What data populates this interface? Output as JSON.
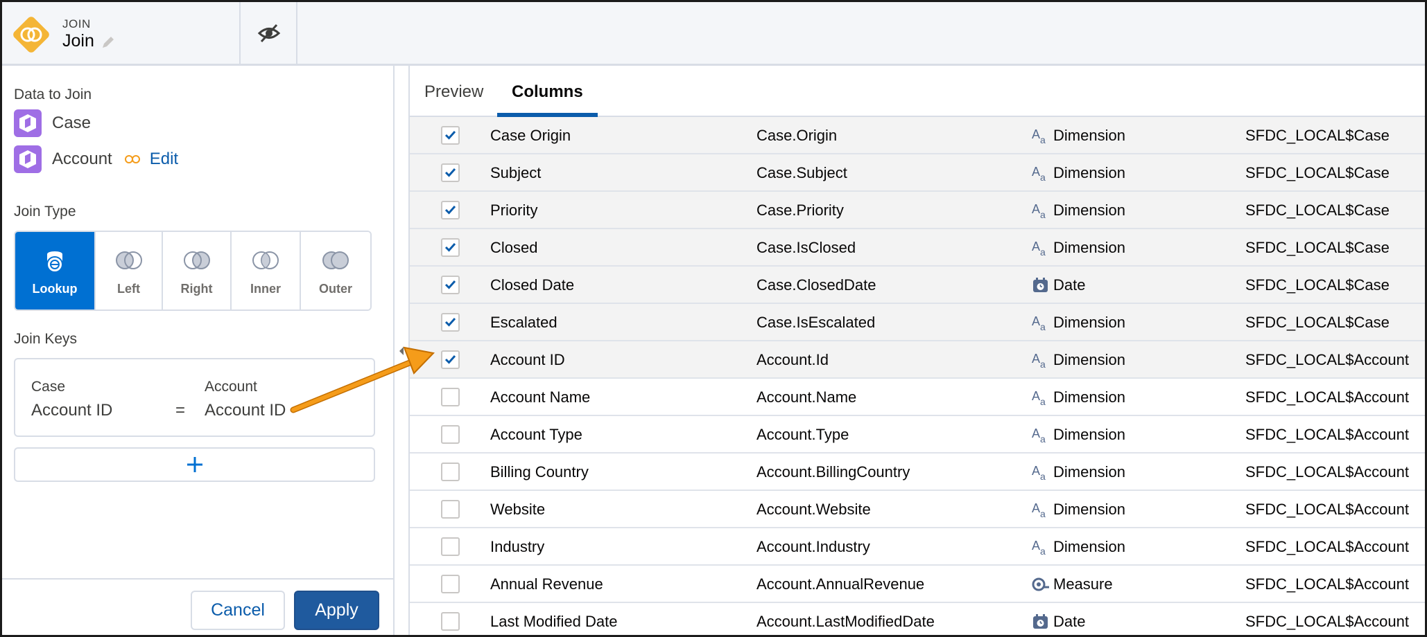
{
  "header": {
    "node_type": "JOIN",
    "node_name": "Join"
  },
  "data_to_join": {
    "label": "Data to Join",
    "sources": [
      {
        "name": "Case"
      },
      {
        "name": "Account",
        "edit_label": "Edit"
      }
    ]
  },
  "join_type": {
    "label": "Join Type",
    "options": [
      "Lookup",
      "Left",
      "Right",
      "Inner",
      "Outer"
    ],
    "selected": "Lookup"
  },
  "join_keys": {
    "label": "Join Keys",
    "left_header": "Case",
    "right_header": "Account",
    "left_value": "Account ID",
    "operator": "=",
    "right_value": "Account ID"
  },
  "footer": {
    "cancel_label": "Cancel",
    "apply_label": "Apply"
  },
  "tabs": {
    "preview": "Preview",
    "columns": "Columns",
    "active": "Columns"
  },
  "colors": {
    "accent": "#0070d2",
    "node_icon": "#f4b536",
    "dataset_icon": "#9f6ee5",
    "arrow": "#f59c1a"
  },
  "columns": [
    {
      "checked": true,
      "label": "Case Origin",
      "api": "Case.Origin",
      "type": "Dimension",
      "icon": "text-type-icon",
      "source": "SFDC_LOCAL$Case"
    },
    {
      "checked": true,
      "label": "Subject",
      "api": "Case.Subject",
      "type": "Dimension",
      "icon": "text-type-icon",
      "source": "SFDC_LOCAL$Case"
    },
    {
      "checked": true,
      "label": "Priority",
      "api": "Case.Priority",
      "type": "Dimension",
      "icon": "text-type-icon",
      "source": "SFDC_LOCAL$Case"
    },
    {
      "checked": true,
      "label": "Closed",
      "api": "Case.IsClosed",
      "type": "Dimension",
      "icon": "text-type-icon",
      "source": "SFDC_LOCAL$Case"
    },
    {
      "checked": true,
      "label": "Closed Date",
      "api": "Case.ClosedDate",
      "type": "Date",
      "icon": "calendar-icon",
      "source": "SFDC_LOCAL$Case"
    },
    {
      "checked": true,
      "label": "Escalated",
      "api": "Case.IsEscalated",
      "type": "Dimension",
      "icon": "text-type-icon",
      "source": "SFDC_LOCAL$Case"
    },
    {
      "checked": true,
      "label": "Account ID",
      "api": "Account.Id",
      "type": "Dimension",
      "icon": "text-type-icon",
      "source": "SFDC_LOCAL$Account"
    },
    {
      "checked": false,
      "label": "Account Name",
      "api": "Account.Name",
      "type": "Dimension",
      "icon": "text-type-icon",
      "source": "SFDC_LOCAL$Account"
    },
    {
      "checked": false,
      "label": "Account Type",
      "api": "Account.Type",
      "type": "Dimension",
      "icon": "text-type-icon",
      "source": "SFDC_LOCAL$Account"
    },
    {
      "checked": false,
      "label": "Billing Country",
      "api": "Account.BillingCountry",
      "type": "Dimension",
      "icon": "text-type-icon",
      "source": "SFDC_LOCAL$Account"
    },
    {
      "checked": false,
      "label": "Website",
      "api": "Account.Website",
      "type": "Dimension",
      "icon": "text-type-icon",
      "source": "SFDC_LOCAL$Account"
    },
    {
      "checked": false,
      "label": "Industry",
      "api": "Account.Industry",
      "type": "Dimension",
      "icon": "text-type-icon",
      "source": "SFDC_LOCAL$Account"
    },
    {
      "checked": false,
      "label": "Annual Revenue",
      "api": "Account.AnnualRevenue",
      "type": "Measure",
      "icon": "measure-icon",
      "source": "SFDC_LOCAL$Account"
    },
    {
      "checked": false,
      "label": "Last Modified Date",
      "api": "Account.LastModifiedDate",
      "type": "Date",
      "icon": "calendar-icon",
      "source": "SFDC_LOCAL$Account"
    }
  ]
}
